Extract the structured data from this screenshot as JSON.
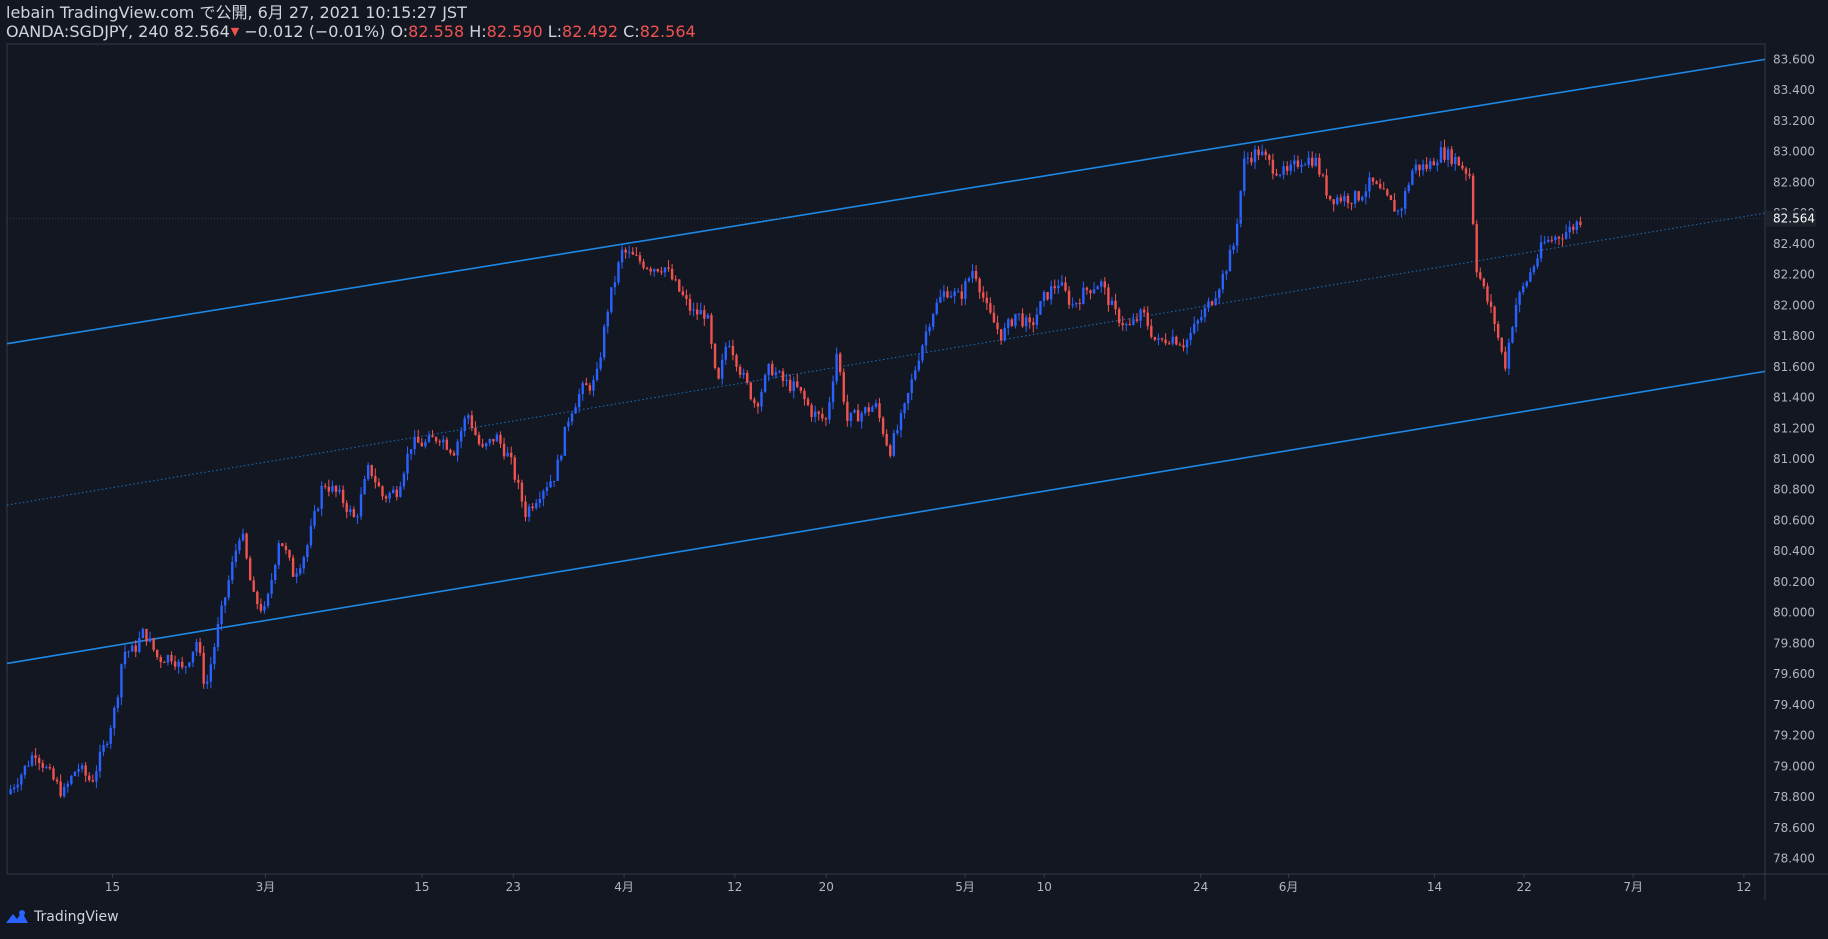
{
  "header": {
    "publisher": "lebain TradingView.com で公開, 6月 27, 2021 10:15:27 JST",
    "symbol": "OANDA:SGDJPY, 240",
    "last": "82.564",
    "change": "−0.012 (−0.01%)",
    "o_label": "O:",
    "o_value": "82.558",
    "h_label": "H:",
    "h_value": "82.590",
    "l_label": "L:",
    "l_value": "82.492",
    "c_label": "C:",
    "c_value": "82.564"
  },
  "footer": {
    "brand": "TradingView"
  },
  "colors": {
    "background": "#131722",
    "up": "#2962ff",
    "down": "#ef5350",
    "channel": "#1e88e5",
    "grid_text": "#b2b5be"
  },
  "chart_data": {
    "type": "candlestick",
    "symbol": "OANDA:SGDJPY",
    "interval": "240",
    "ylim": [
      78.3,
      83.7
    ],
    "y_ticks": [
      "83.600",
      "83.400",
      "83.200",
      "83.000",
      "82.800",
      "82.600",
      "82.400",
      "82.200",
      "82.000",
      "81.800",
      "81.600",
      "81.400",
      "81.200",
      "81.000",
      "80.800",
      "80.600",
      "80.400",
      "80.200",
      "80.000",
      "79.800",
      "79.600",
      "79.400",
      "79.200",
      "79.000",
      "78.800",
      "78.600",
      "78.400"
    ],
    "last_price_label": "82.564",
    "x_ticks": [
      {
        "label": "15",
        "t": 0.06
      },
      {
        "label": "3月",
        "t": 0.147
      },
      {
        "label": "15",
        "t": 0.236
      },
      {
        "label": "23",
        "t": 0.288
      },
      {
        "label": "4月",
        "t": 0.351
      },
      {
        "label": "12",
        "t": 0.414
      },
      {
        "label": "20",
        "t": 0.466
      },
      {
        "label": "5月",
        "t": 0.545
      },
      {
        "label": "10",
        "t": 0.59
      },
      {
        "label": "24",
        "t": 0.679
      },
      {
        "label": "6月",
        "t": 0.729
      },
      {
        "label": "14",
        "t": 0.812
      },
      {
        "label": "22",
        "t": 0.863
      },
      {
        "label": "7月",
        "t": 0.925
      },
      {
        "label": "12",
        "t": 0.988
      }
    ],
    "price_path": [
      [
        0.0,
        78.82
      ],
      [
        0.008,
        78.95
      ],
      [
        0.016,
        79.1
      ],
      [
        0.024,
        78.95
      ],
      [
        0.032,
        78.82
      ],
      [
        0.04,
        79.0
      ],
      [
        0.048,
        78.9
      ],
      [
        0.056,
        79.15
      ],
      [
        0.062,
        79.4
      ],
      [
        0.066,
        79.75
      ],
      [
        0.072,
        79.75
      ],
      [
        0.078,
        79.88
      ],
      [
        0.086,
        79.7
      ],
      [
        0.094,
        79.72
      ],
      [
        0.1,
        79.62
      ],
      [
        0.108,
        79.82
      ],
      [
        0.113,
        79.5
      ],
      [
        0.12,
        79.9
      ],
      [
        0.126,
        80.2
      ],
      [
        0.133,
        80.55
      ],
      [
        0.14,
        80.1
      ],
      [
        0.147,
        80.0
      ],
      [
        0.155,
        80.5
      ],
      [
        0.163,
        80.25
      ],
      [
        0.17,
        80.4
      ],
      [
        0.18,
        80.85
      ],
      [
        0.19,
        80.75
      ],
      [
        0.198,
        80.6
      ],
      [
        0.206,
        80.95
      ],
      [
        0.214,
        80.75
      ],
      [
        0.222,
        80.8
      ],
      [
        0.23,
        81.1
      ],
      [
        0.238,
        81.1
      ],
      [
        0.246,
        81.15
      ],
      [
        0.254,
        81.05
      ],
      [
        0.262,
        81.3
      ],
      [
        0.27,
        81.05
      ],
      [
        0.278,
        81.15
      ],
      [
        0.286,
        81.0
      ],
      [
        0.295,
        80.65
      ],
      [
        0.304,
        80.8
      ],
      [
        0.312,
        80.9
      ],
      [
        0.32,
        81.3
      ],
      [
        0.327,
        81.45
      ],
      [
        0.335,
        81.5
      ],
      [
        0.342,
        82.0
      ],
      [
        0.35,
        82.35
      ],
      [
        0.358,
        82.3
      ],
      [
        0.366,
        82.25
      ],
      [
        0.374,
        82.25
      ],
      [
        0.382,
        82.1
      ],
      [
        0.39,
        81.95
      ],
      [
        0.398,
        81.95
      ],
      [
        0.404,
        81.45
      ],
      [
        0.41,
        81.8
      ],
      [
        0.418,
        81.55
      ],
      [
        0.426,
        81.35
      ],
      [
        0.434,
        81.6
      ],
      [
        0.442,
        81.5
      ],
      [
        0.45,
        81.45
      ],
      [
        0.458,
        81.3
      ],
      [
        0.466,
        81.25
      ],
      [
        0.472,
        81.7
      ],
      [
        0.478,
        81.25
      ],
      [
        0.486,
        81.3
      ],
      [
        0.494,
        81.35
      ],
      [
        0.502,
        81.05
      ],
      [
        0.51,
        81.3
      ],
      [
        0.518,
        81.65
      ],
      [
        0.526,
        81.95
      ],
      [
        0.534,
        82.1
      ],
      [
        0.542,
        82.05
      ],
      [
        0.55,
        82.25
      ],
      [
        0.558,
        81.95
      ],
      [
        0.566,
        81.8
      ],
      [
        0.574,
        81.95
      ],
      [
        0.582,
        81.85
      ],
      [
        0.59,
        82.05
      ],
      [
        0.598,
        82.15
      ],
      [
        0.606,
        82.0
      ],
      [
        0.614,
        82.1
      ],
      [
        0.622,
        82.15
      ],
      [
        0.63,
        81.95
      ],
      [
        0.638,
        81.85
      ],
      [
        0.646,
        81.95
      ],
      [
        0.654,
        81.75
      ],
      [
        0.662,
        81.8
      ],
      [
        0.67,
        81.75
      ],
      [
        0.678,
        81.9
      ],
      [
        0.686,
        82.05
      ],
      [
        0.692,
        82.2
      ],
      [
        0.698,
        82.4
      ],
      [
        0.704,
        82.95
      ],
      [
        0.712,
        83.0
      ],
      [
        0.72,
        82.9
      ],
      [
        0.728,
        82.85
      ],
      [
        0.736,
        82.95
      ],
      [
        0.744,
        82.95
      ],
      [
        0.752,
        82.7
      ],
      [
        0.76,
        82.7
      ],
      [
        0.768,
        82.7
      ],
      [
        0.776,
        82.8
      ],
      [
        0.784,
        82.7
      ],
      [
        0.792,
        82.6
      ],
      [
        0.8,
        82.9
      ],
      [
        0.808,
        82.9
      ],
      [
        0.816,
        83.0
      ],
      [
        0.824,
        82.95
      ],
      [
        0.832,
        82.85
      ],
      [
        0.836,
        82.25
      ],
      [
        0.84,
        82.1
      ],
      [
        0.846,
        81.9
      ],
      [
        0.852,
        81.6
      ],
      [
        0.858,
        82.0
      ],
      [
        0.866,
        82.2
      ],
      [
        0.874,
        82.4
      ],
      [
        0.882,
        82.45
      ],
      [
        0.89,
        82.5
      ],
      [
        0.895,
        82.56
      ]
    ],
    "channel_lines": [
      {
        "name": "upper",
        "x": [
          0.0,
          1.0
        ],
        "y": [
          81.75,
          83.6
        ]
      },
      {
        "name": "middle",
        "x": [
          0.0,
          1.0
        ],
        "y": [
          80.7,
          82.6
        ]
      },
      {
        "name": "lower",
        "x": [
          0.0,
          1.0
        ],
        "y": [
          79.67,
          81.57
        ]
      }
    ]
  }
}
